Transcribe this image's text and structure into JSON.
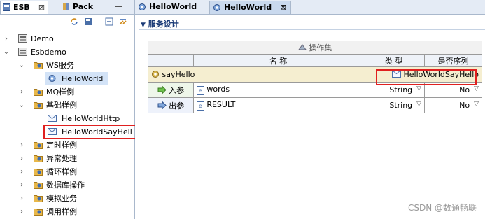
{
  "left": {
    "tabs": [
      {
        "label": "ESB",
        "close": "⊠",
        "icon": "esb-icon"
      },
      {
        "label": "Pack",
        "icon": "package-icon"
      }
    ],
    "tree": [
      {
        "label": "Demo",
        "level": 0,
        "expanded": false,
        "icon": "project-icon"
      },
      {
        "label": "Esbdemo",
        "level": 0,
        "expanded": true,
        "icon": "project-icon"
      },
      {
        "label": "WS服务",
        "level": 1,
        "expanded": true,
        "icon": "folder-gear-icon"
      },
      {
        "label": "HelloWorld",
        "level": 2,
        "icon": "gear-icon",
        "selected": true
      },
      {
        "label": "MQ样例",
        "level": 1,
        "expanded": false,
        "icon": "folder-gear-icon"
      },
      {
        "label": "基础样例",
        "level": 1,
        "expanded": true,
        "icon": "folder-gear-icon"
      },
      {
        "label": "HelloWorldHttp",
        "level": 2,
        "icon": "envelope-icon"
      },
      {
        "label": "HelloWorldSayHell",
        "level": 2,
        "icon": "envelope-icon",
        "highlighted": true
      },
      {
        "label": "定时样例",
        "level": 1,
        "expanded": false,
        "icon": "folder-gear-icon"
      },
      {
        "label": "异常处理",
        "level": 1,
        "expanded": false,
        "icon": "folder-gear-icon"
      },
      {
        "label": "循环样例",
        "level": 1,
        "expanded": false,
        "icon": "folder-gear-icon"
      },
      {
        "label": "数据库操作",
        "level": 1,
        "expanded": false,
        "icon": "folder-gear-icon"
      },
      {
        "label": "模拟业务",
        "level": 1,
        "expanded": false,
        "icon": "folder-gear-icon"
      },
      {
        "label": "调用样例",
        "level": 1,
        "expanded": false,
        "icon": "folder-gear-icon"
      }
    ]
  },
  "editor": {
    "tabs": [
      {
        "label": "HelloWorld",
        "active": false
      },
      {
        "label": "HelloWorld",
        "active": true,
        "close": "⊠"
      }
    ],
    "section_title": "服务设计",
    "section_arrow": "▼",
    "table": {
      "caption": "操作集",
      "headers": [
        "名 称",
        "类  型",
        "是否序列"
      ],
      "method": {
        "name": "sayHello",
        "type": "HelloWorldSayHello"
      },
      "params": [
        {
          "dir": "入参",
          "name": "words",
          "type": "String",
          "seq": "No"
        },
        {
          "dir": "出参",
          "name": "RESULT",
          "type": "String",
          "seq": "No"
        }
      ]
    }
  },
  "watermark": "CSDN @数通畅联"
}
